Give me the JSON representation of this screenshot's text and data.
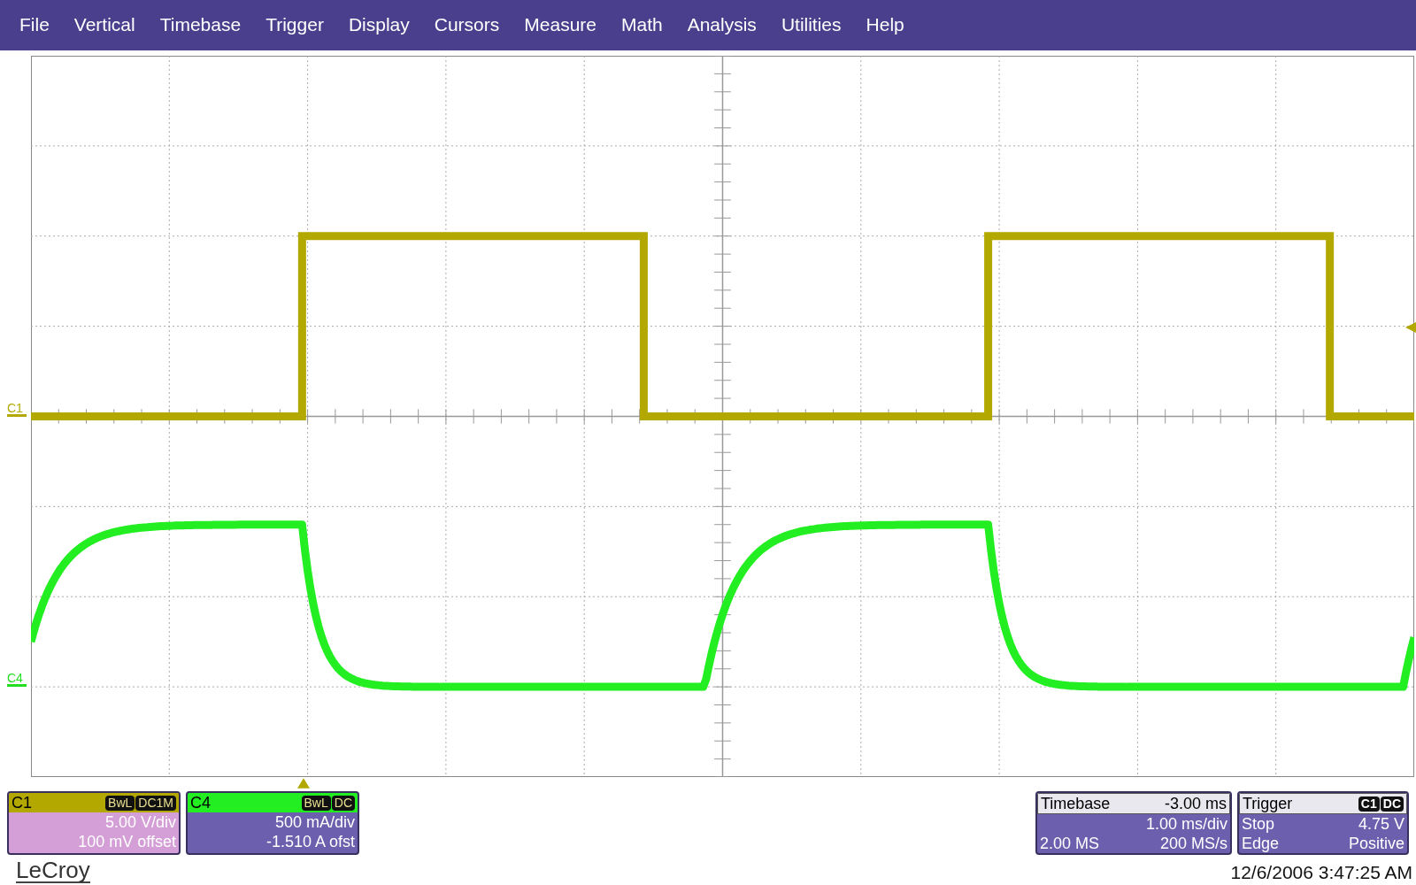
{
  "menu": [
    "File",
    "Vertical",
    "Timebase",
    "Trigger",
    "Display",
    "Cursors",
    "Measure",
    "Math",
    "Analysis",
    "Utilities",
    "Help"
  ],
  "trace_markers": [
    {
      "label": "C1",
      "color": "#b3a800"
    },
    {
      "label": "C4",
      "color": "#22dd22"
    }
  ],
  "channels": [
    {
      "label": "C1",
      "color": "#b3a800",
      "tags": [
        "BwL",
        "DC1M"
      ],
      "lines": [
        "5.00 V/div",
        "100 mV offset"
      ]
    },
    {
      "label": "C4",
      "color": "#22ee22",
      "tags": [
        "BwL",
        "DC"
      ],
      "lines": [
        "500 mA/div",
        "-1.510 A ofst"
      ]
    }
  ],
  "timebase": {
    "title": "Timebase",
    "value": "-3.00 ms",
    "rows": [
      {
        "right": "1.00 ms/div"
      },
      {
        "left": "2.00 MS",
        "right": "200 MS/s"
      }
    ]
  },
  "trigger": {
    "title": "Trigger",
    "tags": [
      "C1",
      "DC"
    ],
    "rows": [
      {
        "left": "Stop",
        "right": "4.75 V"
      },
      {
        "left": "Edge",
        "right": "Positive"
      }
    ]
  },
  "brand": "LeCroy",
  "timestamp": "12/6/2006 3:47:25 AM"
}
